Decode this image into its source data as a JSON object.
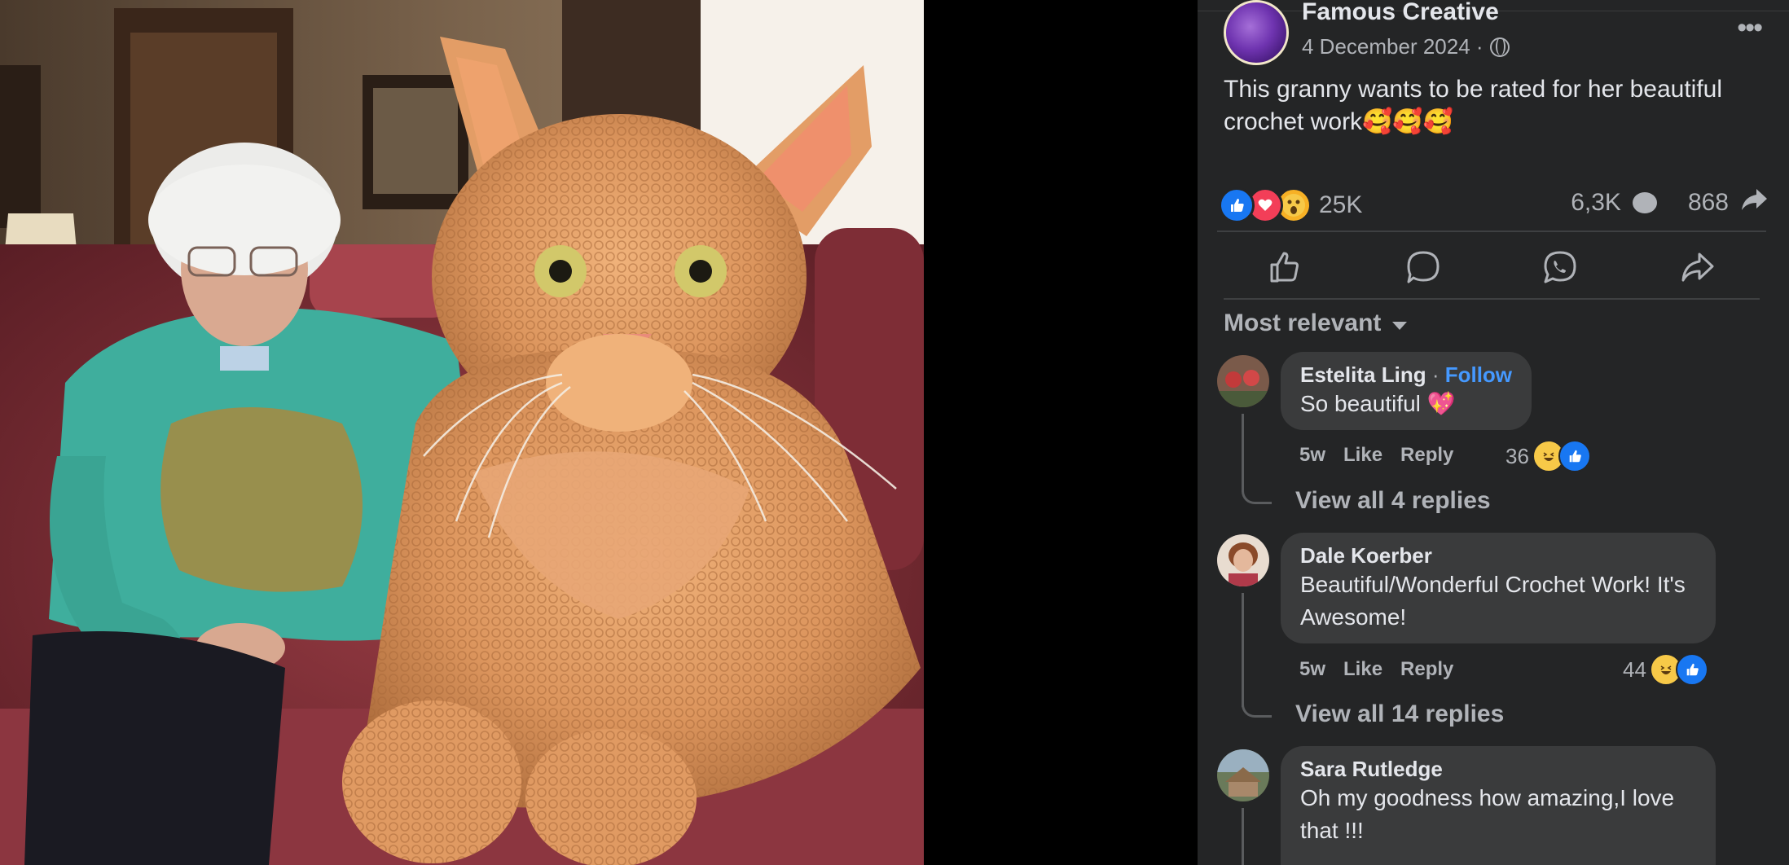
{
  "post": {
    "page_name": "Famous Creative",
    "date": "4 December 2024 ·",
    "more": "•••",
    "caption": "This granny wants to be rated for her beautiful crochet work🥰🥰🥰"
  },
  "stats": {
    "reaction_count": "25K",
    "comment_count": "6,3K",
    "share_count": "868",
    "reaction_icons": [
      "like-icon",
      "love-icon",
      "wow-icon"
    ]
  },
  "actions": [
    "like-action",
    "comment-action",
    "whatsapp-action",
    "share-action"
  ],
  "filter": {
    "label": "Most relevant"
  },
  "comments": [
    {
      "author": "Estelita Ling",
      "follow": "Follow",
      "separator": "·",
      "text": "So beautiful 💖",
      "time": "5w",
      "like": "Like",
      "reply": "Reply",
      "react_count": "36",
      "view_replies": "View all 4 replies"
    },
    {
      "author": "Dale Koerber",
      "text": "Beautiful/Wonderful Crochet Work! It's Awesome!",
      "time": "5w",
      "like": "Like",
      "reply": "Reply",
      "react_count": "44",
      "view_replies": "View all 14 replies"
    },
    {
      "author": "Sara Rutledge",
      "text": "Oh my goodness how amazing,I love that !!!"
    }
  ],
  "colors": {
    "panel_bg": "#242526",
    "bubble_bg": "#3a3b3c",
    "link_blue": "#4599ff",
    "like_blue": "#1877f2"
  }
}
